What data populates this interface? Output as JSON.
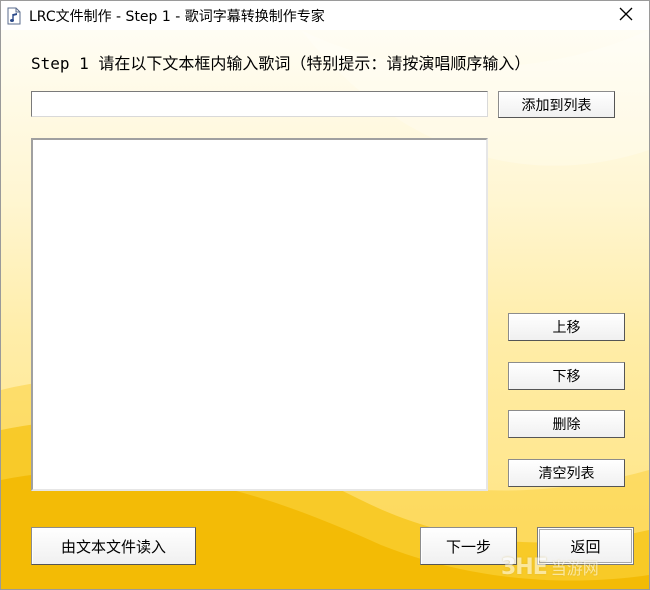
{
  "window": {
    "title": "LRC文件制作 - Step 1 - 歌词字幕转换制作专家",
    "close_glyph": "✕"
  },
  "step": {
    "prompt": "Step 1  请在以下文本框内输入歌词（特别提示：请按演唱顺序输入）"
  },
  "lyric_input": {
    "value": "",
    "placeholder": ""
  },
  "lyrics_list": {
    "items": []
  },
  "buttons": {
    "add_to_list": "添加到列表",
    "move_up": "上移",
    "move_down": "下移",
    "delete": "删除",
    "clear_list": "清空列表",
    "load_from_file": "由文本文件读入",
    "next_step": "下一步",
    "back": "返回"
  },
  "watermark": {
    "logo": "3HE",
    "text": "当游网"
  },
  "colors": {
    "background_top": "#fffdf4",
    "background_bottom": "#ffe27a",
    "swoosh": "#f6c415"
  }
}
